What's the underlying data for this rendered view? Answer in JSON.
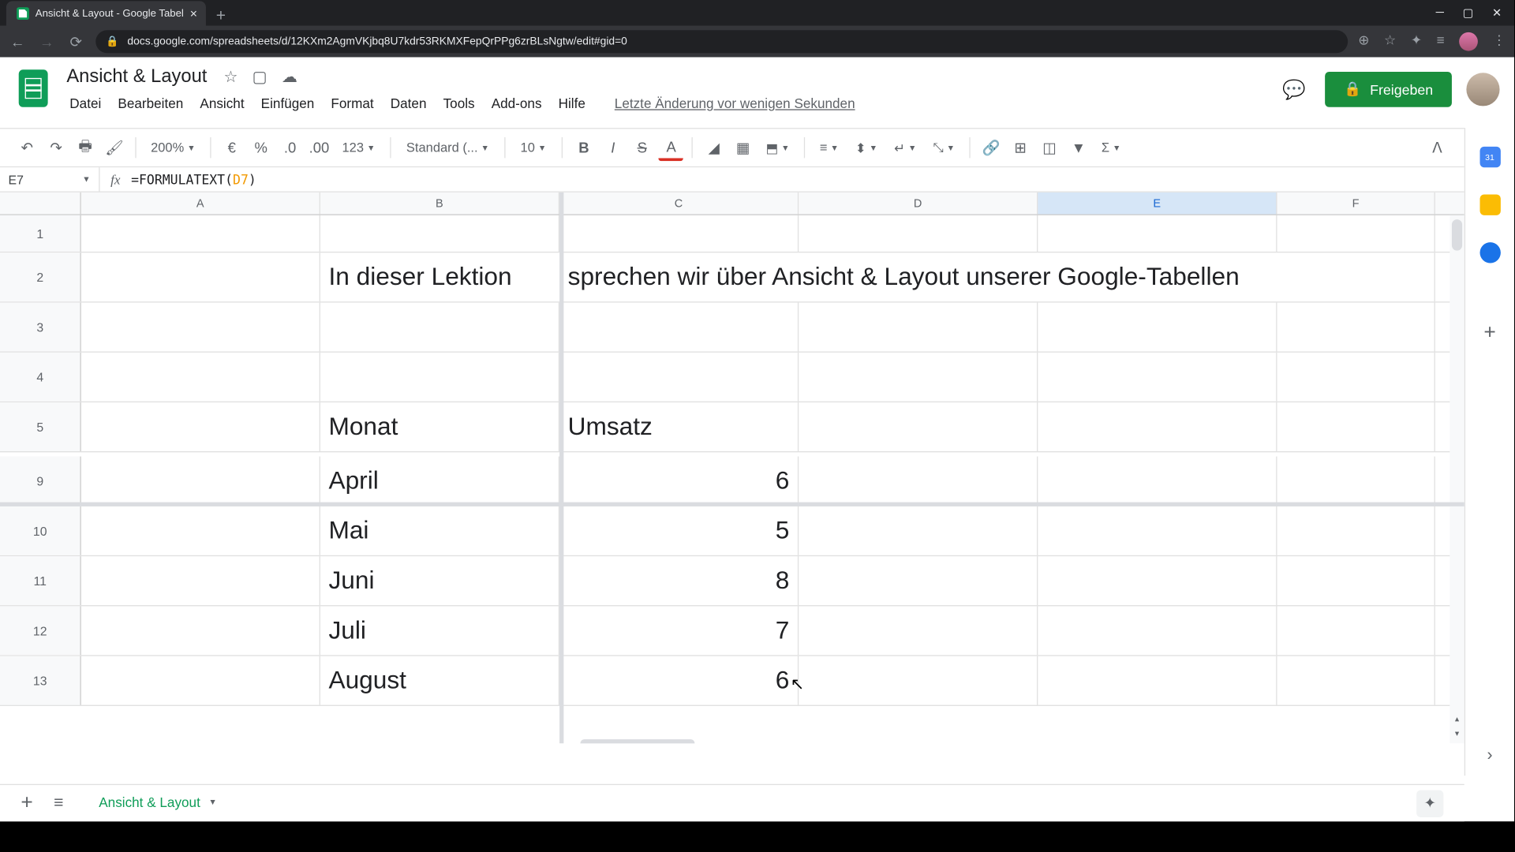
{
  "browser": {
    "tab_title": "Ansicht & Layout - Google Tabel",
    "url": "docs.google.com/spreadsheets/d/12KXm2AgmVKjbq8U7kdr53RKMXFepQrPPg6zrBLsNgtw/edit#gid=0"
  },
  "doc": {
    "title": "Ansicht & Layout",
    "menus": [
      "Datei",
      "Bearbeiten",
      "Ansicht",
      "Einfügen",
      "Format",
      "Daten",
      "Tools",
      "Add-ons",
      "Hilfe"
    ],
    "last_edit": "Letzte Änderung vor wenigen Sekunden",
    "share_label": "Freigeben"
  },
  "toolbar": {
    "zoom": "200%",
    "font": "Standard (...",
    "font_size": "10",
    "number_fmt": "123"
  },
  "formula": {
    "name_box": "E7",
    "prefix": "=FORMULATEXT(",
    "ref": "D7",
    "suffix": ")"
  },
  "columns": [
    "A",
    "B",
    "C",
    "D",
    "E",
    "F"
  ],
  "selected_column": "E",
  "rows_top": [
    {
      "n": "1",
      "B": "",
      "C": ""
    },
    {
      "n": "2",
      "B": "In dieser Lektion",
      "C": "sprechen wir über Ansicht & Layout unserer Google-Tabellen",
      "overflow": true
    },
    {
      "n": "3",
      "B": "",
      "C": ""
    },
    {
      "n": "4",
      "B": "",
      "C": ""
    },
    {
      "n": "5",
      "B": "Monat",
      "C": "Umsatz",
      "c_left": true
    }
  ],
  "rows_bottom": [
    {
      "n": "9",
      "B": "April",
      "C": "6"
    },
    {
      "n": "10",
      "B": "Mai",
      "C": "5"
    },
    {
      "n": "11",
      "B": "Juni",
      "C": "8"
    },
    {
      "n": "12",
      "B": "Juli",
      "C": "7"
    },
    {
      "n": "13",
      "B": "August",
      "C": "6"
    }
  ],
  "sheet_tab": "Ansicht & Layout"
}
